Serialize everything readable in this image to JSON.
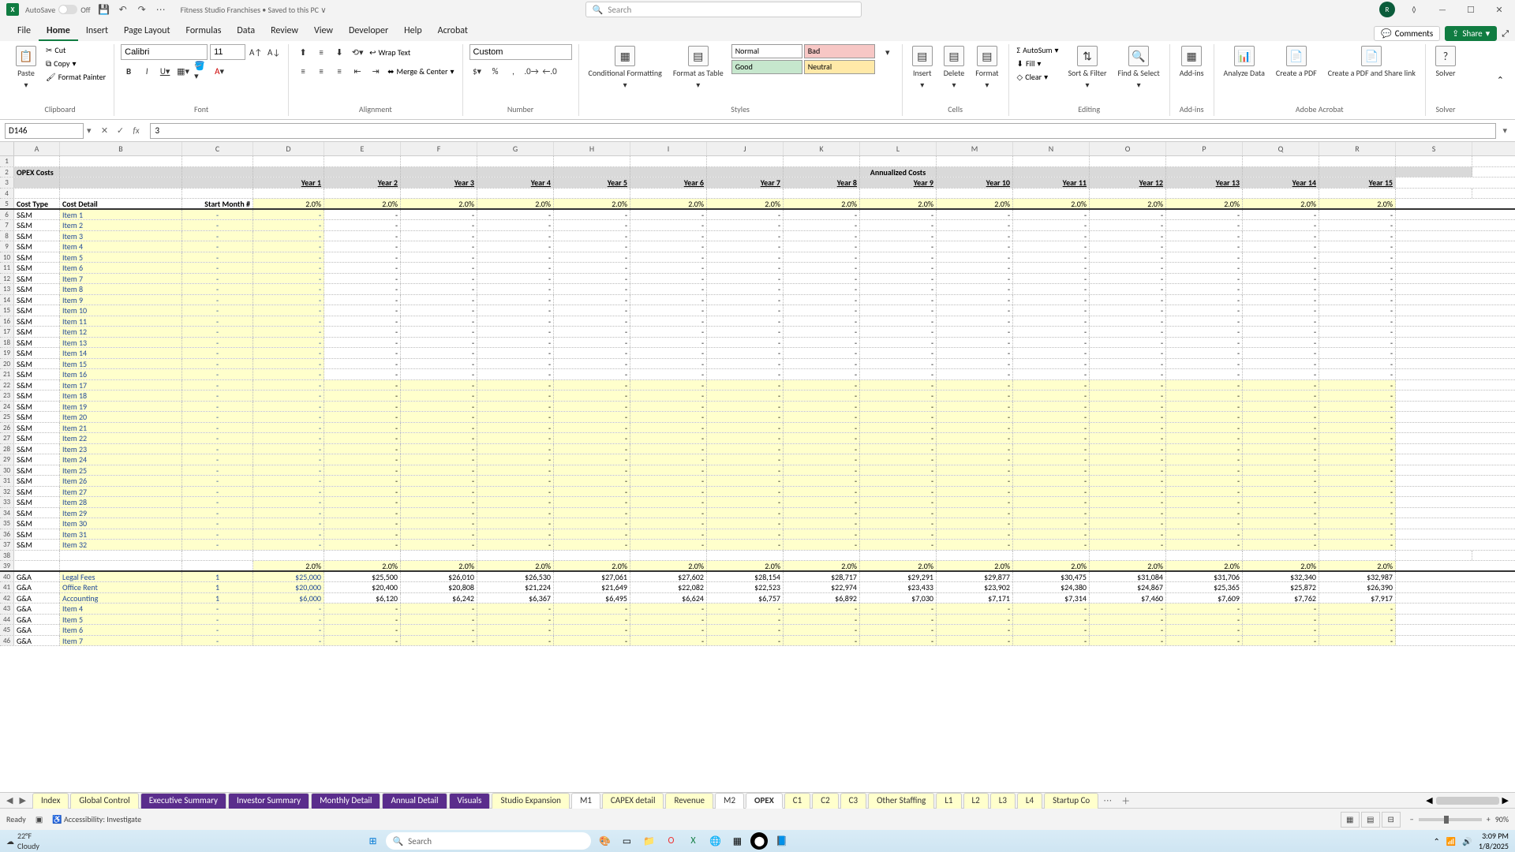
{
  "titlebar": {
    "autosave": "AutoSave",
    "autosave_state": "Off",
    "filename": "Fitness Studio Franchises • Saved to this PC ∨",
    "search_placeholder": "Search",
    "avatar": "R"
  },
  "ribbon_tabs": [
    "File",
    "Home",
    "Insert",
    "Page Layout",
    "Formulas",
    "Data",
    "Review",
    "View",
    "Developer",
    "Help",
    "Acrobat"
  ],
  "ribbon_active": "Home",
  "comments_btn": "Comments",
  "share_btn": "Share",
  "ribbon": {
    "clipboard": {
      "paste": "Paste",
      "cut": "Cut",
      "copy": "Copy",
      "fp": "Format Painter",
      "label": "Clipboard"
    },
    "font": {
      "name": "Calibri",
      "size": "11",
      "label": "Font"
    },
    "alignment": {
      "wrap": "Wrap Text",
      "merge": "Merge & Center",
      "label": "Alignment"
    },
    "number": {
      "format": "Custom",
      "label": "Number"
    },
    "styles": {
      "cond": "Conditional Formatting",
      "fat": "Format as Table",
      "normal": "Normal",
      "bad": "Bad",
      "good": "Good",
      "neutral": "Neutral",
      "label": "Styles"
    },
    "cells": {
      "insert": "Insert",
      "delete": "Delete",
      "format": "Format",
      "label": "Cells"
    },
    "editing": {
      "autosum": "AutoSum",
      "fill": "Fill",
      "clear": "Clear",
      "sort": "Sort & Filter",
      "find": "Find & Select",
      "label": "Editing"
    },
    "addins": {
      "addins": "Add-ins",
      "label": "Add-ins"
    },
    "acrobat": {
      "analyze": "Analyze Data",
      "create": "Create a PDF",
      "share": "Create a PDF and Share link",
      "label": "Adobe Acrobat"
    },
    "solver": {
      "solver": "Solver",
      "label": "Solver"
    }
  },
  "fbar": {
    "namebox": "D146",
    "formula": "3"
  },
  "columns": [
    "A",
    "B",
    "C",
    "D",
    "E",
    "F",
    "G",
    "H",
    "I",
    "J",
    "K",
    "L",
    "M",
    "N",
    "O",
    "P",
    "Q",
    "R",
    "S"
  ],
  "header2_A": "OPEX Costs",
  "header2_center": "Annualized Costs",
  "years": [
    "Year 1",
    "Year 2",
    "Year 3",
    "Year 4",
    "Year 5",
    "Year 6",
    "Year 7",
    "Year 8",
    "Year 9",
    "Year 10",
    "Year 11",
    "Year 12",
    "Year 13",
    "Year 14",
    "Year 15"
  ],
  "row5": {
    "a": "Cost Type",
    "b": "Cost Detail",
    "c": "Start Month #",
    "pct": "2.0%"
  },
  "sm_rows": [
    {
      "r": 6,
      "b": "Item 1"
    },
    {
      "r": 7,
      "b": "Item 2"
    },
    {
      "r": 8,
      "b": "Item 3"
    },
    {
      "r": 9,
      "b": "Item 4"
    },
    {
      "r": 10,
      "b": "Item 5"
    },
    {
      "r": 11,
      "b": "Item 6"
    },
    {
      "r": 12,
      "b": "Item 7"
    },
    {
      "r": 13,
      "b": "Item 8"
    },
    {
      "r": 14,
      "b": "Item 9"
    },
    {
      "r": 15,
      "b": "Item 10"
    },
    {
      "r": 16,
      "b": "Item 11"
    },
    {
      "r": 17,
      "b": "Item 12"
    },
    {
      "r": 18,
      "b": "Item 13"
    },
    {
      "r": 19,
      "b": "Item 14"
    },
    {
      "r": 20,
      "b": "Item 15"
    },
    {
      "r": 21,
      "b": "Item 16"
    },
    {
      "r": 22,
      "b": "Item 17"
    },
    {
      "r": 23,
      "b": "Item 18"
    },
    {
      "r": 24,
      "b": "Item 19"
    },
    {
      "r": 25,
      "b": "Item 20"
    },
    {
      "r": 26,
      "b": "Item 21"
    },
    {
      "r": 27,
      "b": "Item 22"
    },
    {
      "r": 28,
      "b": "Item 23"
    },
    {
      "r": 29,
      "b": "Item 24"
    },
    {
      "r": 30,
      "b": "Item 25"
    },
    {
      "r": 31,
      "b": "Item 26"
    },
    {
      "r": 32,
      "b": "Item 27"
    },
    {
      "r": 33,
      "b": "Item 28"
    },
    {
      "r": 34,
      "b": "Item 29"
    },
    {
      "r": 35,
      "b": "Item 30"
    },
    {
      "r": 36,
      "b": "Item 31"
    },
    {
      "r": 37,
      "b": "Item 32"
    }
  ],
  "sm_label": "S&M",
  "pct39": "2.0%",
  "ga_label": "G&A",
  "ga_rows": [
    {
      "r": 40,
      "b": "Legal Fees",
      "c": "1",
      "d": "$25,000",
      "vals": [
        "$25,500",
        "$26,010",
        "$26,530",
        "$27,061",
        "$27,602",
        "$28,154",
        "$28,717",
        "$29,291",
        "$29,877",
        "$30,475",
        "$31,084",
        "$31,706",
        "$32,340",
        "$32,987"
      ]
    },
    {
      "r": 41,
      "b": "Office Rent",
      "c": "1",
      "d": "$20,000",
      "vals": [
        "$20,400",
        "$20,808",
        "$21,224",
        "$21,649",
        "$22,082",
        "$22,523",
        "$22,974",
        "$23,433",
        "$23,902",
        "$24,380",
        "$24,867",
        "$25,365",
        "$25,872",
        "$26,390"
      ]
    },
    {
      "r": 42,
      "b": "Accounting",
      "c": "1",
      "d": "$6,000",
      "vals": [
        "$6,120",
        "$6,242",
        "$6,367",
        "$6,495",
        "$6,624",
        "$6,757",
        "$6,892",
        "$7,030",
        "$7,171",
        "$7,314",
        "$7,460",
        "$7,609",
        "$7,762",
        "$7,917"
      ]
    },
    {
      "r": 43,
      "b": "Item 4",
      "c": "-",
      "d": "-",
      "vals": [
        "-",
        "-",
        "-",
        "-",
        "-",
        "-",
        "-",
        "-",
        "-",
        "-",
        "-",
        "-",
        "-",
        "-"
      ]
    },
    {
      "r": 44,
      "b": "Item 5",
      "c": "-",
      "d": "-",
      "vals": [
        "-",
        "-",
        "-",
        "-",
        "-",
        "-",
        "-",
        "-",
        "-",
        "-",
        "-",
        "-",
        "-",
        "-"
      ]
    },
    {
      "r": 45,
      "b": "Item 6",
      "c": "-",
      "d": "-",
      "vals": [
        "-",
        "-",
        "-",
        "-",
        "-",
        "-",
        "-",
        "-",
        "-",
        "-",
        "-",
        "-",
        "-",
        "-"
      ]
    },
    {
      "r": 46,
      "b": "Item 7",
      "c": "-",
      "d": "-",
      "vals": [
        "-",
        "-",
        "-",
        "-",
        "-",
        "-",
        "-",
        "-",
        "-",
        "-",
        "-",
        "-",
        "-",
        "-"
      ]
    }
  ],
  "sheet_tabs": [
    {
      "name": "Index",
      "cls": "yellow"
    },
    {
      "name": "Global Control",
      "cls": "yellow"
    },
    {
      "name": "Executive Summary",
      "cls": "purple"
    },
    {
      "name": "Investor Summary",
      "cls": "purple"
    },
    {
      "name": "Monthly Detail",
      "cls": "purple"
    },
    {
      "name": "Annual Detail",
      "cls": "purple"
    },
    {
      "name": "Visuals",
      "cls": "purple"
    },
    {
      "name": "Studio Expansion",
      "cls": "yellow"
    },
    {
      "name": "M1",
      "cls": "white"
    },
    {
      "name": "CAPEX detail",
      "cls": "yellow"
    },
    {
      "name": "Revenue",
      "cls": "yellow"
    },
    {
      "name": "M2",
      "cls": "white"
    },
    {
      "name": "OPEX",
      "cls": "active"
    },
    {
      "name": "C1",
      "cls": "yellow"
    },
    {
      "name": "C2",
      "cls": "yellow"
    },
    {
      "name": "C3",
      "cls": "yellow"
    },
    {
      "name": "Other Staffing",
      "cls": "yellow"
    },
    {
      "name": "L1",
      "cls": "yellow"
    },
    {
      "name": "L2",
      "cls": "yellow"
    },
    {
      "name": "L3",
      "cls": "yellow"
    },
    {
      "name": "L4",
      "cls": "yellow"
    },
    {
      "name": "Startup Co",
      "cls": "yellow"
    }
  ],
  "status": {
    "ready": "Ready",
    "access": "Accessibility: Investigate",
    "zoom": "90%"
  },
  "taskbar": {
    "temp": "22°F",
    "cond": "Cloudy",
    "search": "Search",
    "time": "3:09 PM",
    "date": "1/8/2025"
  }
}
